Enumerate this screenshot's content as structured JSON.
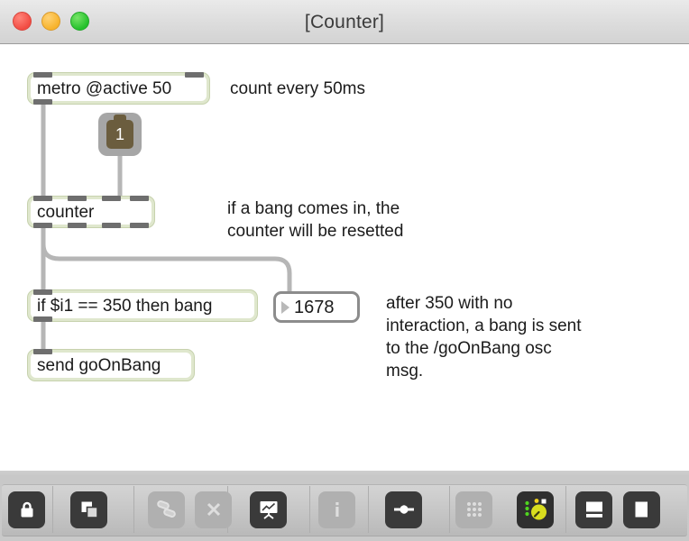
{
  "window": {
    "title": "[Counter]",
    "traffic_lights": [
      {
        "name": "close",
        "color": "#f24c43"
      },
      {
        "name": "minimize",
        "color": "#f7b32c"
      },
      {
        "name": "zoom",
        "color": "#25c12c"
      }
    ]
  },
  "patch": {
    "objects": [
      {
        "id": "metro",
        "label": "metro @active 50",
        "type": "object"
      },
      {
        "id": "counter",
        "label": "counter",
        "type": "object"
      },
      {
        "id": "ifbang",
        "label": "if $i1 == 350 then bang",
        "type": "object"
      },
      {
        "id": "send",
        "label": "send goOnBang",
        "type": "object"
      }
    ],
    "toggle": {
      "value": "1",
      "state": "on"
    },
    "number_box": {
      "value": "1678"
    },
    "comments": [
      {
        "id": "c1",
        "text": "count every 50ms"
      },
      {
        "id": "c2",
        "text": "if a bang comes in, the\ncounter will be resetted"
      },
      {
        "id": "c3",
        "text": "after 350 with no\ninteraction, a bang is sent\nto the /goOnBang osc\nmsg."
      }
    ],
    "colors": {
      "object_fill": "#dfe7cd",
      "object_inner": "#ffffff",
      "nub": "#6e6e6e",
      "cable": "#b6b6b6",
      "toggle_outer": "#a6a6a6",
      "toggle_inner": "#6b5d3e",
      "canvas": "#ffffff"
    }
  },
  "toolbar": {
    "items": [
      {
        "name": "edit-lock-icon",
        "title": "Edit / Lock",
        "enabled": true
      },
      {
        "name": "objects-icon",
        "title": "Objects",
        "enabled": true
      },
      {
        "name": "cables-icon",
        "title": "Cables",
        "enabled": false
      },
      {
        "name": "delete-icon",
        "title": "Delete",
        "enabled": false
      },
      {
        "name": "presentation-icon",
        "title": "Presentation",
        "enabled": true
      },
      {
        "name": "info-icon",
        "title": "Info",
        "enabled": false
      },
      {
        "name": "node-icon",
        "title": "Node",
        "enabled": true
      },
      {
        "name": "grid-icon",
        "title": "Grid",
        "enabled": false
      },
      {
        "name": "knob-icon",
        "title": "Controls",
        "enabled": true
      },
      {
        "name": "panel-bottom-icon",
        "title": "Bottom panel",
        "enabled": true
      },
      {
        "name": "panel-full-icon",
        "title": "Full panel",
        "enabled": true
      }
    ]
  }
}
